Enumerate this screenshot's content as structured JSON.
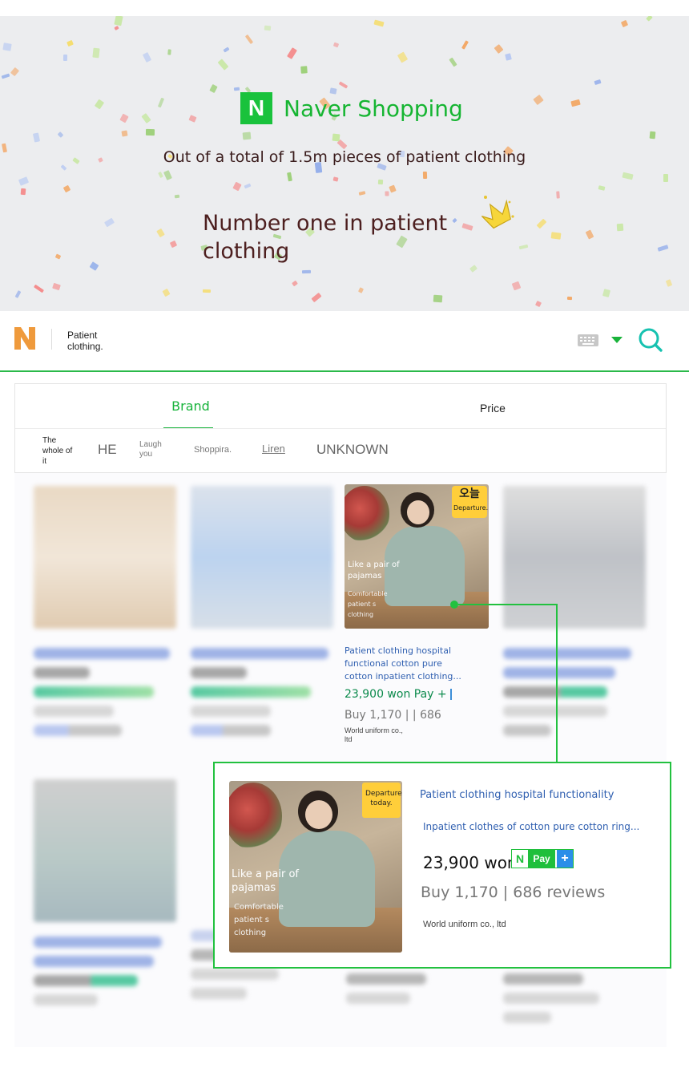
{
  "banner": {
    "brand_letter": "N",
    "brand_name": "Naver Shopping",
    "subtitle": "Out of a total of 1.5m pieces of patient clothing",
    "headline": "Number one in patient clothing",
    "crown_icon": "crown-icon"
  },
  "search": {
    "logo_letter": "N",
    "query": "Patient clothing.",
    "icons": [
      "keyboard-icon",
      "chevron-down-icon",
      "search-icon"
    ],
    "accent_color": "#19b33a"
  },
  "filters": {
    "tabs": [
      {
        "label": "Brand",
        "active": true
      },
      {
        "label": "Price",
        "active": false
      }
    ],
    "brands": [
      "The whole of it",
      "HE",
      "Laugh you",
      "Shoppira.",
      "Liren",
      "UNKNOWN"
    ]
  },
  "product": {
    "badge_top": "오늘",
    "badge_bottom": "Departure.",
    "image_caption": "Like a pair of pajamas",
    "image_subcaption": "Comfortable patient s clothing",
    "title": "Patient clothing hospital functional cotton pure cotton inpatient clothing...",
    "price": "23,900 won Pay +",
    "buy": "Buy 1,170 | | 686",
    "seller": "World uniform co., ltd"
  },
  "callout": {
    "badge": "Departure today.",
    "image_caption": "Like a pair of pajamas",
    "image_subcaption": "Comfortable patient s clothing",
    "title_line1": "Patient clothing hospital functionality",
    "title_line2": "Inpatient clothes of cotton pure cotton ring...",
    "price": "23,900 won",
    "npay_n": "N",
    "npay_label": "Pay",
    "npay_plus": "+",
    "buy": "Buy 1,170 | 686 reviews",
    "seller": "World uniform co., ltd"
  },
  "colors": {
    "naver_green": "#19c23c",
    "link_blue": "#2f5fb0",
    "price_green": "#0b8a4c",
    "badge_yellow": "#ffce3a"
  }
}
